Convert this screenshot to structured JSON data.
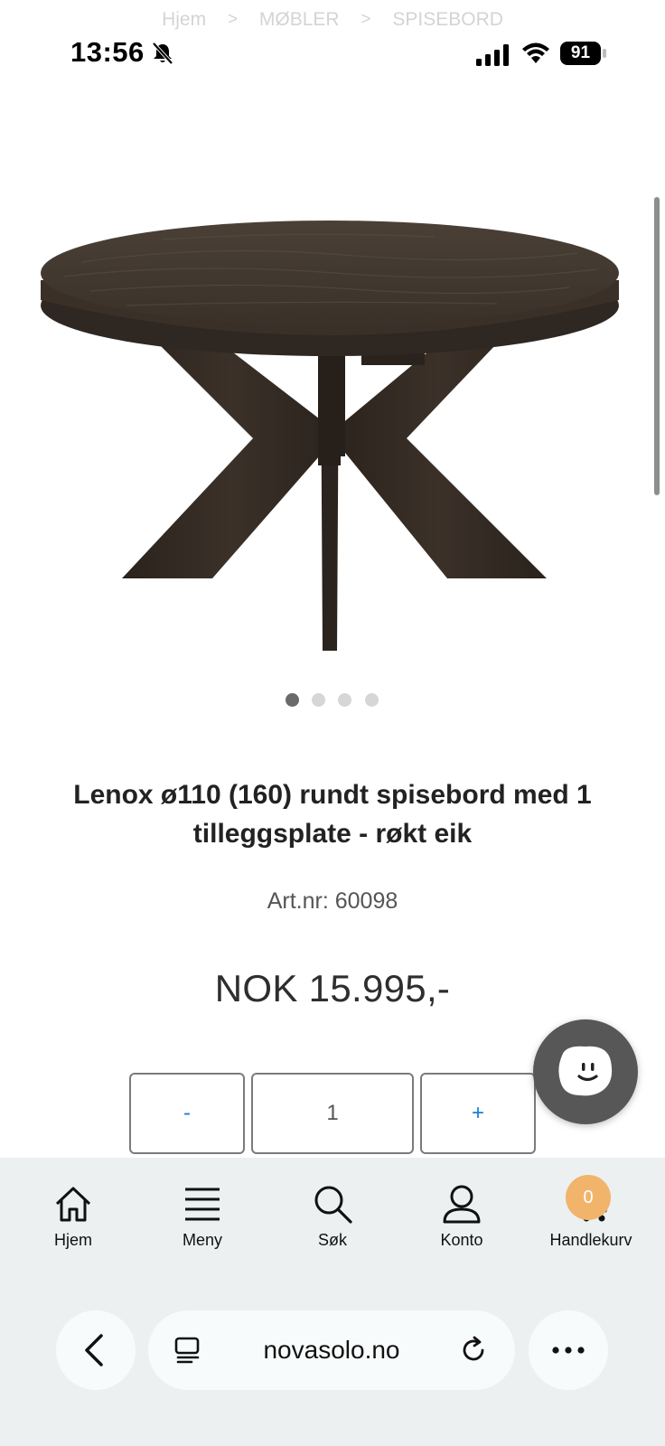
{
  "breadcrumb": {
    "items": [
      "Hjem",
      "MØBLER",
      "SPISEBORD"
    ],
    "separator": ">"
  },
  "status_bar": {
    "time": "13:56",
    "battery": "91",
    "icons": [
      "bell-slash-icon",
      "signal-icon",
      "wifi-icon",
      "battery-icon"
    ]
  },
  "gallery": {
    "slides": 4,
    "active_index": 0,
    "image_alt": "round-dining-table-smoked-oak"
  },
  "product": {
    "title": "Lenox ø110 (160) rundt spisebord med 1 tilleggsplate - røkt eik",
    "art_label": "Art.nr: ",
    "art_number": "60098",
    "price": "NOK 15.995,-"
  },
  "quantity": {
    "minus_label": "-",
    "value": "1",
    "plus_label": "+"
  },
  "nav": {
    "items": [
      {
        "label": "Hjem",
        "icon": "home-icon"
      },
      {
        "label": "Meny",
        "icon": "menu-icon"
      },
      {
        "label": "Søk",
        "icon": "search-icon"
      },
      {
        "label": "Konto",
        "icon": "user-icon"
      },
      {
        "label": "Handlekurv",
        "icon": "cart-icon"
      }
    ],
    "cart_count": "0"
  },
  "browser": {
    "url": "novasolo.no"
  },
  "colors": {
    "accent_blue": "#1a7fd4",
    "badge": "#f2b46b",
    "chat": "#575757",
    "panel": "#ecf0f0",
    "wood_dark": "#3a3128"
  }
}
